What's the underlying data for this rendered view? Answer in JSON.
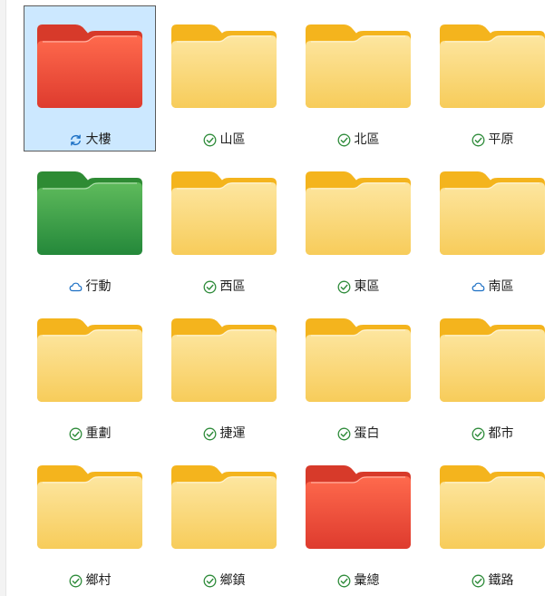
{
  "colors": {
    "yellow": {
      "back": "#f4b41d",
      "front_top": "#fde6a0",
      "front_bottom": "#f7cc5a"
    },
    "red": {
      "back": "#d73a2a",
      "front_top": "#ff6a4d",
      "front_bottom": "#de3b2e"
    },
    "green": {
      "back": "#2e8b34",
      "front_top": "#5fbb5c",
      "front_bottom": "#24883a"
    },
    "status_synced": "#2e8b3a",
    "status_cloud": "#1b6fc4",
    "status_syncing": "#1b6fc4",
    "selection_bg": "#cce8ff"
  },
  "folders": [
    {
      "name": "大樓",
      "color": "red",
      "status": "syncing-icon",
      "selected": true
    },
    {
      "name": "山區",
      "color": "yellow",
      "status": "synced-check-icon"
    },
    {
      "name": "北區",
      "color": "yellow",
      "status": "synced-check-icon"
    },
    {
      "name": "平原",
      "color": "yellow",
      "status": "synced-check-icon"
    },
    {
      "name": "行動",
      "color": "green",
      "status": "cloud-icon"
    },
    {
      "name": "西區",
      "color": "yellow",
      "status": "synced-check-icon"
    },
    {
      "name": "東區",
      "color": "yellow",
      "status": "synced-check-icon"
    },
    {
      "name": "南區",
      "color": "yellow",
      "status": "cloud-icon"
    },
    {
      "name": "重劃",
      "color": "yellow",
      "status": "synced-check-icon"
    },
    {
      "name": "捷運",
      "color": "yellow",
      "status": "synced-check-icon"
    },
    {
      "name": "蛋白",
      "color": "yellow",
      "status": "synced-check-icon"
    },
    {
      "name": "都市",
      "color": "yellow",
      "status": "synced-check-icon"
    },
    {
      "name": "鄉村",
      "color": "yellow",
      "status": "synced-check-icon"
    },
    {
      "name": "鄉鎮",
      "color": "yellow",
      "status": "synced-check-icon"
    },
    {
      "name": "彙總",
      "color": "red",
      "status": "synced-check-icon"
    },
    {
      "name": "鐵路",
      "color": "yellow",
      "status": "synced-check-icon"
    }
  ]
}
